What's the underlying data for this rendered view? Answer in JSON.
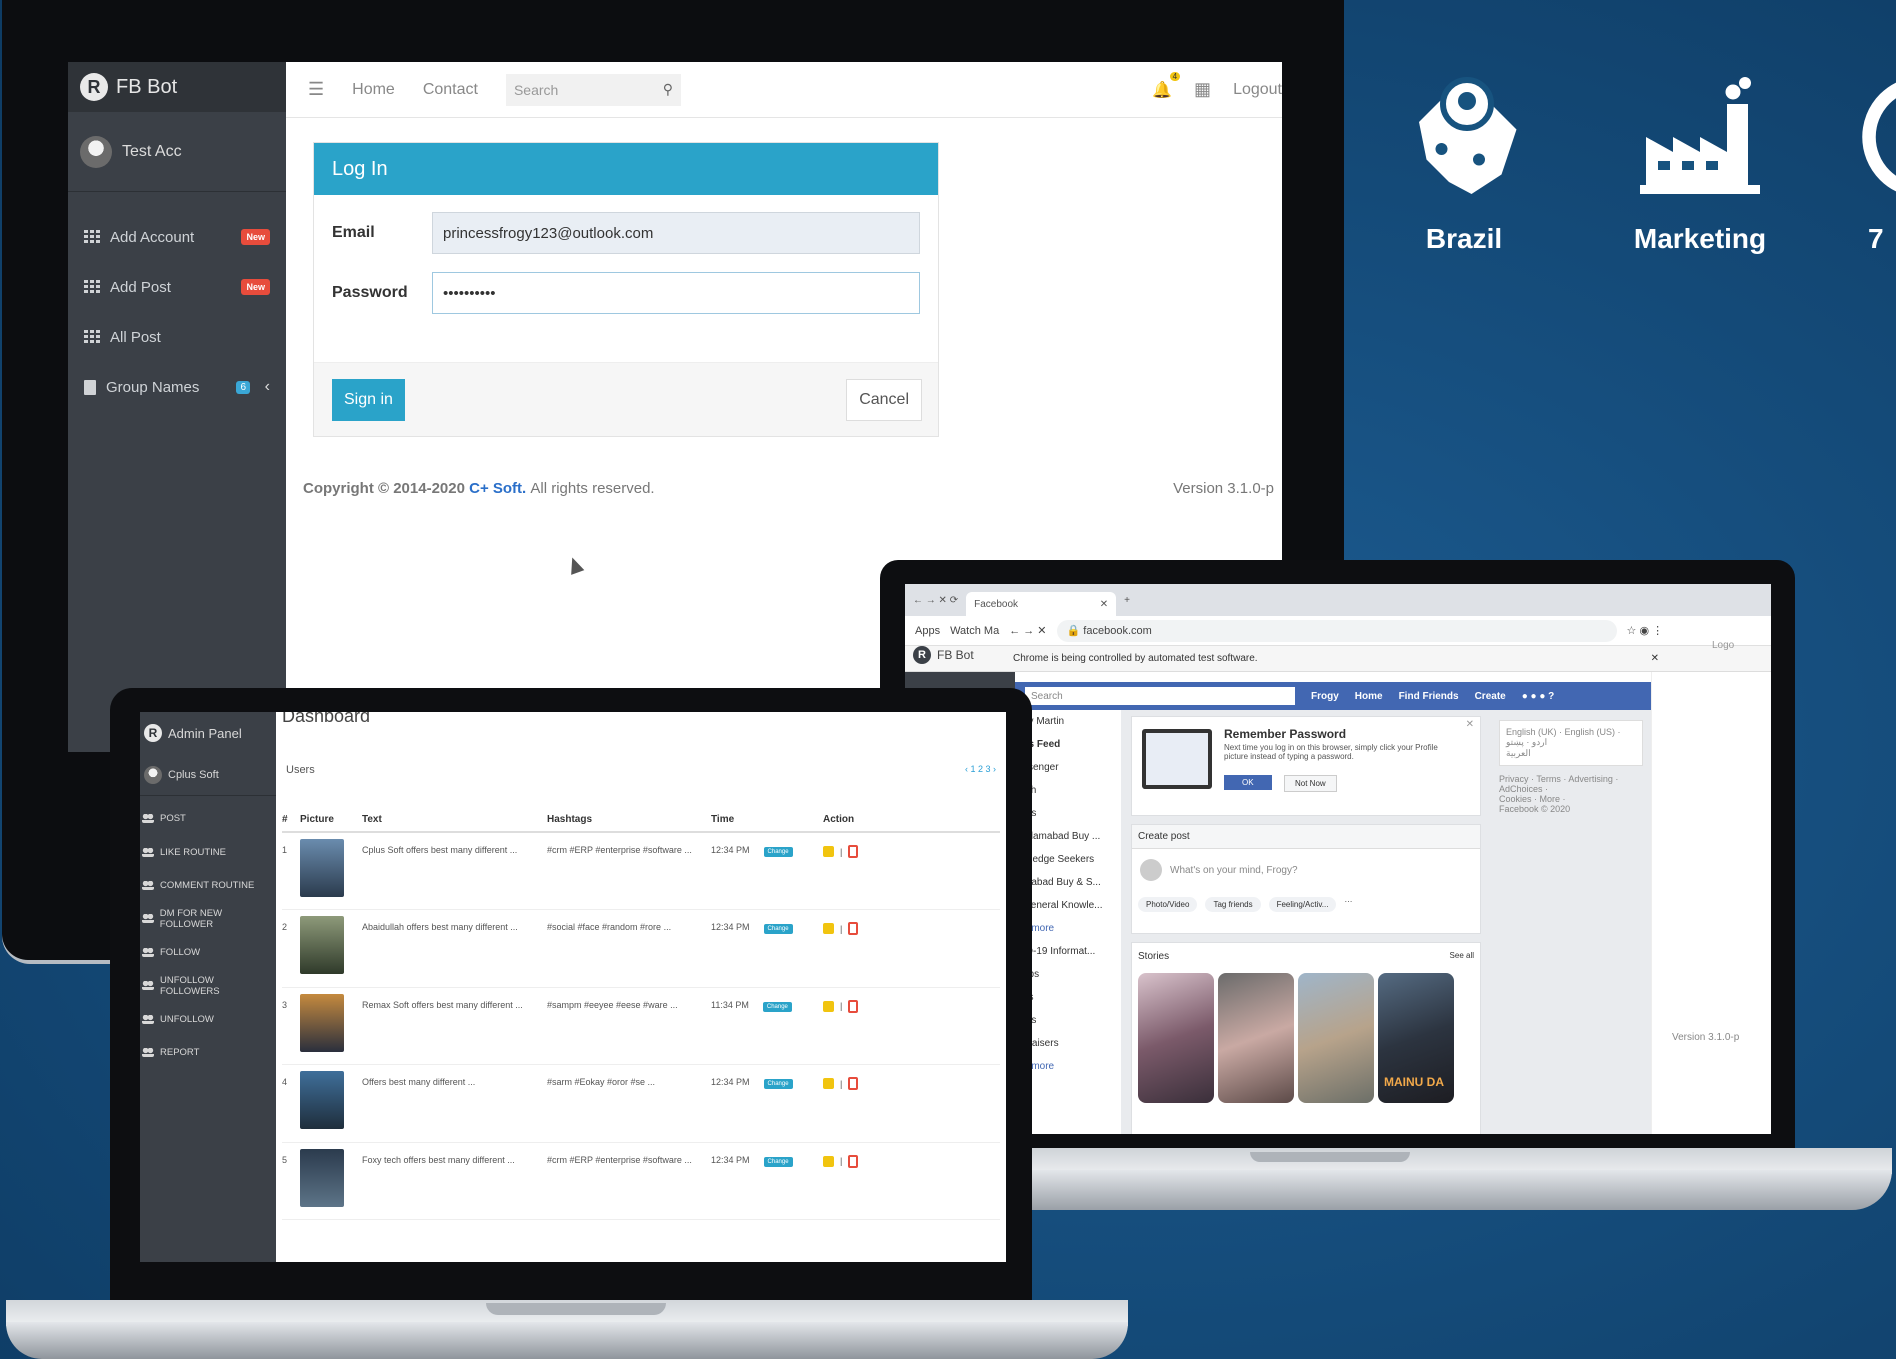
{
  "monitor": {
    "brand": "FB Bot",
    "user": "Test Acc",
    "sidebar": [
      {
        "label": "Add Account",
        "badge": "New"
      },
      {
        "label": "Add Post",
        "badge": "New"
      },
      {
        "label": "All Post",
        "badge": ""
      },
      {
        "label": "Group Names",
        "count": "6"
      }
    ],
    "nav": {
      "home": "Home",
      "contact": "Contact",
      "search_placeholder": "Search",
      "logout": "Logout",
      "notif_count": "4"
    },
    "login": {
      "title": "Log In",
      "email_label": "Email",
      "email_value": "princessfrogy123@outlook.com",
      "password_label": "Password",
      "password_value": "••••••••••",
      "signin": "Sign in",
      "cancel": "Cancel"
    },
    "footer": {
      "copy_prefix": "Copyright © 2014-2020",
      "brand": "C+ Soft.",
      "rights": "All rights reserved.",
      "version": "Version 3.1.0-p"
    }
  },
  "laptop_right": {
    "tab": "Facebook",
    "bookmarks": [
      "Apps",
      "Watch Ma"
    ],
    "url": "facebook.com",
    "automation_msg": "Chrome is being controlled by automated test software.",
    "brand": "FB Bot",
    "fb": {
      "search": "Search",
      "nav": [
        "Frogy",
        "Home",
        "Find Friends",
        "Create"
      ],
      "left": [
        "gy Martin",
        "vs Feed",
        "ssenger",
        "tch",
        "nts",
        "Islamabad Buy ...",
        "wledge Seekers",
        "mabad Buy & S...",
        "General Knowle...",
        "e more",
        "ID-19 Informat...",
        "ups",
        "es",
        "nts",
        "draisers",
        "e more"
      ],
      "remember_title": "Remember Password",
      "remember_text": "Next time you log in on this browser, simply click your Profile picture instead of typing a password.",
      "ok": "OK",
      "not_now": "Not Now",
      "create_post": "Create post",
      "mind": "What's on your mind, Frogy?",
      "actions": [
        "Photo/Video",
        "Tag friends",
        "Feeling/Activ..."
      ],
      "stories": "Stories",
      "see_all": "See all",
      "langs": "English (UK) · English (US) · اردو · پښتو",
      "langs2": "العربية",
      "links": "Privacy · Terms · Advertising · AdChoices ·",
      "links2": "Cookies · More ·",
      "copyright": "Facebook © 2020",
      "story_text": "MAINU DA"
    },
    "right_version": "Version 3.1.0-p",
    "logout": "Logo"
  },
  "laptop_left": {
    "brand": "Admin Panel",
    "user": "Cplus Soft",
    "sidebar": [
      "POST",
      "LIKE ROUTINE",
      "COMMENT ROUTINE",
      "DM FOR NEW FOLLOWER",
      "FOLLOW",
      "UNFOLLOW FOLLOWERS",
      "UNFOLLOW",
      "REPORT"
    ],
    "title": "Dashboard",
    "subtitle": "Users",
    "pagination": "‹ 1 2 3 ›",
    "columns": [
      "#",
      "Picture",
      "Text",
      "Hashtags",
      "Time",
      "Action"
    ],
    "rows": [
      {
        "n": "1",
        "text": "Cplus Soft offers best many different ...",
        "tags": "#crm #ERP #enterprise #software ...",
        "time": "12:34 PM",
        "btn": "Change"
      },
      {
        "n": "2",
        "text": "Abaidullah offers best many different ...",
        "tags": "#social #face #random #rore ...",
        "time": "12:34 PM",
        "btn": "Change"
      },
      {
        "n": "3",
        "text": "Remax Soft offers best many different ...",
        "tags": "#sampm #eeyee #eese #ware ...",
        "time": "11:34 PM",
        "btn": "Change"
      },
      {
        "n": "4",
        "text": "Offers best many different ...",
        "tags": "#sarm #Eokay #oror #se ...",
        "time": "12:34 PM",
        "btn": "Change"
      },
      {
        "n": "5",
        "text": "Foxy tech offers best many different ...",
        "tags": "#crm #ERP #enterprise #software ...",
        "time": "12:34 PM",
        "btn": "Change"
      }
    ]
  },
  "features": [
    {
      "label": "Brazil",
      "icon": "map-pin-icon"
    },
    {
      "label": "Marketing",
      "icon": "factory-icon"
    },
    {
      "label": "7",
      "icon": "clock-icon"
    }
  ]
}
